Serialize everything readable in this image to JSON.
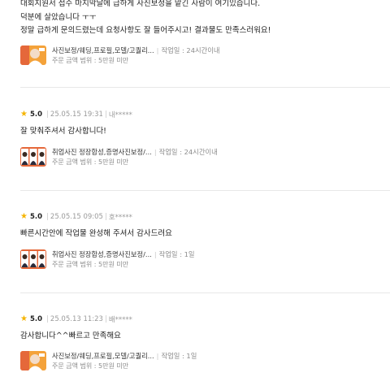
{
  "colors": {
    "star": "#f5b400",
    "divider": "#e8e8e8",
    "thumb_a": "#f4a23a",
    "thumb_b": "#e5683a"
  },
  "top_review": {
    "lines": [
      "대회지원서 접수 마지막날에 급하게 사진보정을 맡긴 사람이 여기있습니다.",
      "덕분에 살았습니다 ㅜㅜ",
      "정말 급하게 문의드렸는데 요청사항도 잘 들어주시고! 결과물도 만족스러워요!"
    ],
    "product": {
      "name": "사진보정/웨딩,프로필,모델/고퀄리...",
      "work_time": "작업일 : 24시간이내",
      "price_range": "주문 금액 범위 : 5만원 미만",
      "thumb_icon": "portrait-thumbnail"
    }
  },
  "reviews": [
    {
      "rating": "5.0",
      "date": "25.05.15 19:31",
      "user": "내*****",
      "text": "잘 맞춰주셔서 감사합니다!",
      "product": {
        "name": "취업사진 정장합성,증명사진보정/...",
        "work_time": "작업일 : 24시간이내",
        "price_range": "주문 금액 범위 : 5만원 미만",
        "thumb_icon": "id-photos-thumbnail"
      }
    },
    {
      "rating": "5.0",
      "date": "25.05.15 09:05",
      "user": "호*****",
      "text": "빠른시간안에 작업물 완성해 주셔서 감사드려요",
      "product": {
        "name": "취업사진 정장합성,증명사진보정/...",
        "work_time": "작업일 : 1일",
        "price_range": "주문 금액 범위 : 5만원 미만",
        "thumb_icon": "id-photos-thumbnail"
      }
    },
    {
      "rating": "5.0",
      "date": "25.05.13 11:23",
      "user": "배*****",
      "text": "감사합니다^^빠르고 만족해요",
      "product": {
        "name": "사진보정/웨딩,프로필,모델/고퀄리...",
        "work_time": "작업일 : 1일",
        "price_range": "주문 금액 범위 : 5만원 미만",
        "thumb_icon": "portrait-thumbnail"
      }
    }
  ]
}
